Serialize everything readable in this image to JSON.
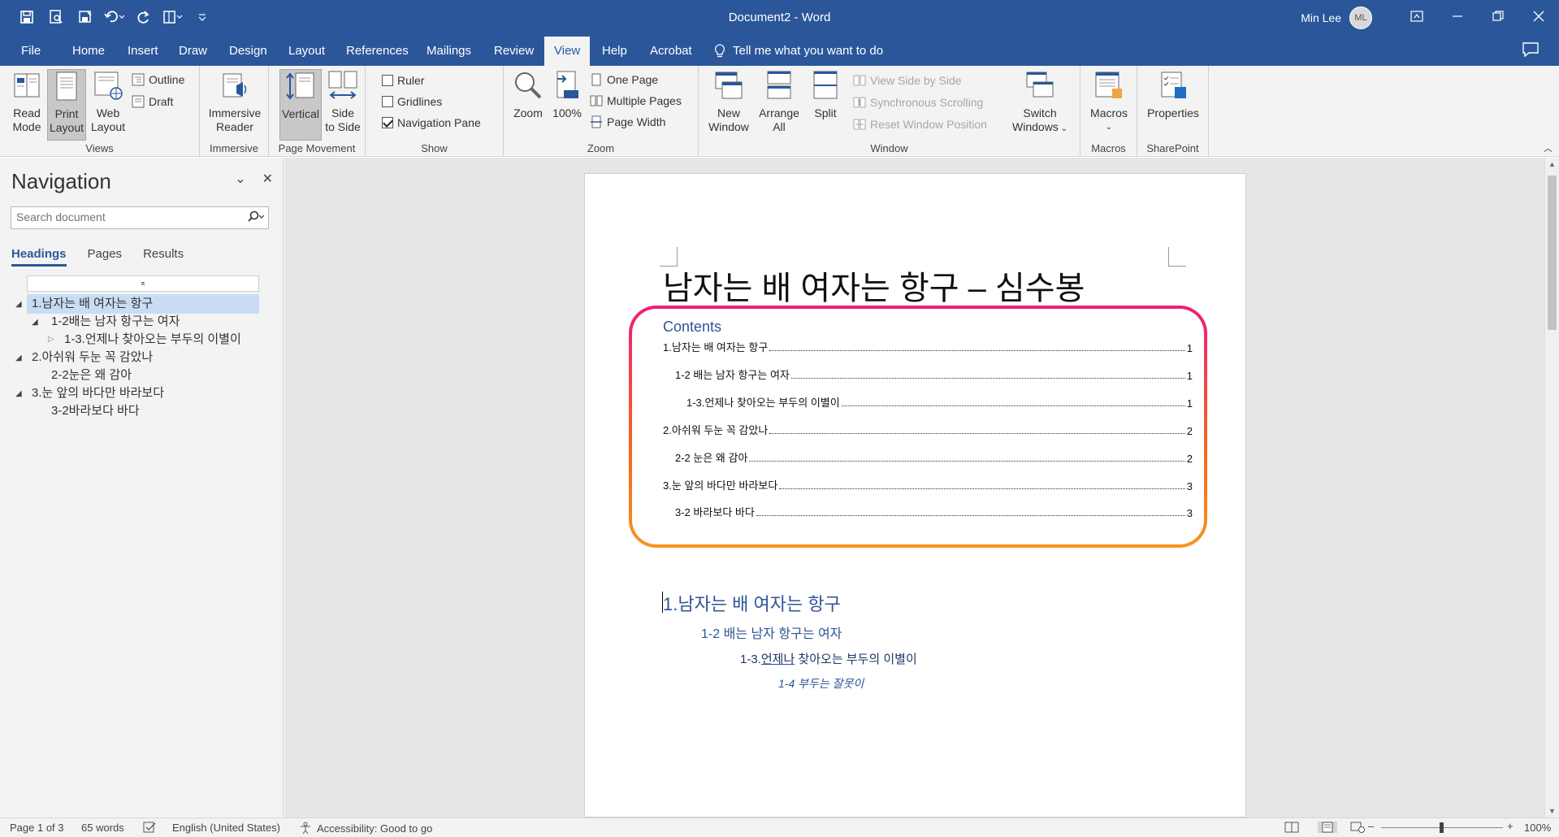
{
  "window": {
    "title": "Document2  -  Word",
    "user_name": "Min Lee",
    "user_initials": "ML"
  },
  "tabs": [
    "File",
    "Home",
    "Insert",
    "Draw",
    "Design",
    "Layout",
    "References",
    "Mailings",
    "Review",
    "View",
    "Help",
    "Acrobat"
  ],
  "active_tab": "View",
  "tell_me": "Tell me what you want to do",
  "ribbon": {
    "views": {
      "label": "Views",
      "read_mode_1": "Read",
      "read_mode_2": "Mode",
      "print_layout_1": "Print",
      "print_layout_2": "Layout",
      "web_layout_1": "Web",
      "web_layout_2": "Layout",
      "outline": "Outline",
      "draft": "Draft"
    },
    "immersive": {
      "label": "Immersive",
      "reader_1": "Immersive",
      "reader_2": "Reader"
    },
    "page_movement": {
      "label": "Page Movement",
      "vertical": "Vertical",
      "side_1": "Side",
      "side_2": "to Side"
    },
    "show": {
      "label": "Show",
      "ruler": "Ruler",
      "gridlines": "Gridlines",
      "navigation_pane": "Navigation Pane"
    },
    "zoom": {
      "label": "Zoom",
      "zoom": "Zoom",
      "percent": "100%",
      "one_page": "One Page",
      "multiple_pages": "Multiple Pages",
      "page_width": "Page Width"
    },
    "window": {
      "label": "Window",
      "new_1": "New",
      "new_2": "Window",
      "arrange_1": "Arrange",
      "arrange_2": "All",
      "split": "Split",
      "view_side_by_side": "View Side by Side",
      "sync_scrolling": "Synchronous Scrolling",
      "reset_position": "Reset Window Position",
      "switch_1": "Switch",
      "switch_2": "Windows"
    },
    "macros": {
      "label": "Macros",
      "macros": "Macros"
    },
    "sharepoint": {
      "label": "SharePoint",
      "properties": "Properties"
    }
  },
  "navigation": {
    "title": "Navigation",
    "search_placeholder": "Search document",
    "tabs": [
      "Headings",
      "Pages",
      "Results"
    ],
    "items": [
      "1.남자는 배 여자는 항구",
      "1-2배는 남자 항구는 여자",
      "1-3.언제나 찾아오는 부두의 이별이",
      "2.아쉬워 두눈 꼭 감았나",
      "2-2눈은 왜 감아",
      "3.눈 앞의 바다만 바라보다",
      "3-2바라보다 바다"
    ]
  },
  "document": {
    "title": "남자는 배 여자는 항구 – 심수봉",
    "toc_heading": "Contents",
    "toc": [
      {
        "text": "1.남자는 배 여자는 항구",
        "page": "1"
      },
      {
        "text": "1-2 배는 남자 항구는 여자",
        "page": "1"
      },
      {
        "text": "1-3.언제나 찾아오는 부두의 이별이",
        "page": "1"
      },
      {
        "text": "2.아쉬워 두눈 꼭 감았나",
        "page": "2"
      },
      {
        "text": "2-2 눈은 왜 감아",
        "page": "2"
      },
      {
        "text": "3.눈 앞의 바다만 바라보다",
        "page": "3"
      },
      {
        "text": "3-2 바라보다 바다",
        "page": "3"
      }
    ],
    "heading1": "1.남자는 배 여자는 항구",
    "heading2": "1-2 배는 남자 항구는 여자",
    "heading3_prefix": "1-3.",
    "heading3_underlined": "언제나",
    "heading3_rest": " 찾아오는 부두의 이별이",
    "heading4": "1-4 부두는 잘못이"
  },
  "status": {
    "page": "Page 1 of 3",
    "words": "65 words",
    "language": "English (United States)",
    "accessibility": "Accessibility: Good to go",
    "zoom": "100%",
    "zoom_minus": "–",
    "zoom_plus": "+"
  },
  "colors": {
    "brand": "#2b579a",
    "heading": "#2f5496",
    "toc_frame_top": "#ee1d7a",
    "toc_frame_bottom": "#f7941d"
  }
}
